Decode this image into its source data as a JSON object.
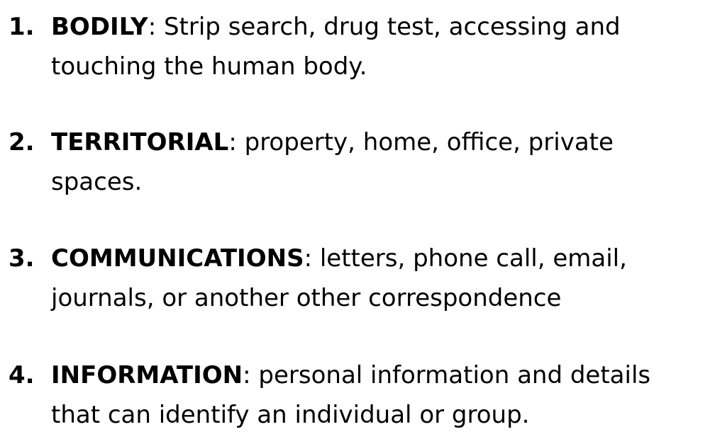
{
  "items": [
    {
      "number": "1.",
      "term": "BODILY",
      "sep": ":",
      "line1": " Strip search, drug test, accessing and",
      "line2": "touching the human body."
    },
    {
      "number": "2.",
      "term": "TERRITORIAL",
      "sep": ":",
      "line1": " property, home, office, private",
      "line2": "spaces."
    },
    {
      "number": "3.",
      "term": "COMMUNICATIONS",
      "sep": ":",
      "line1": " letters, phone call, email,",
      "line2": "journals, or another other correspondence"
    },
    {
      "number": "4.",
      "term": "INFORMATION",
      "sep": ":",
      "line1": " personal information and details",
      "line2": "that can identify an individual or group."
    }
  ]
}
